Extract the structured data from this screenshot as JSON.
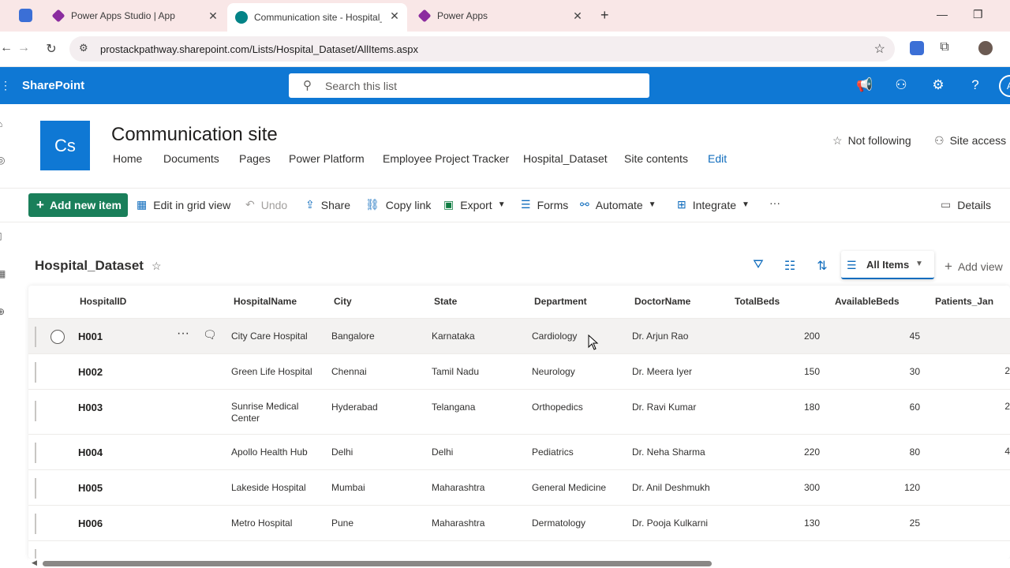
{
  "browser": {
    "tabs": [
      {
        "title": "Power Apps Studio | App",
        "color": "#8b2c9f"
      },
      {
        "title": "Communication site - Hospital_",
        "color": "#038387"
      },
      {
        "title": "Power Apps",
        "color": "#8b2c9f"
      }
    ],
    "url": "prostackpathway.sharepoint.com/Lists/Hospital_Dataset/AllItems.aspx",
    "new_tab": "+"
  },
  "suitebar": {
    "brand": "SharePoint",
    "search_placeholder": "Search this list",
    "avatar_initial": "A"
  },
  "site": {
    "logo": "Cs",
    "title": "Communication site",
    "nav": [
      "Home",
      "Documents",
      "Pages",
      "Power Platform",
      "Employee Project Tracker",
      "Hospital_Dataset",
      "Site contents",
      "Edit"
    ],
    "not_following": "Not following",
    "site_access": "Site access"
  },
  "commands": {
    "new_item": "Add new item",
    "grid_view": "Edit in grid view",
    "undo": "Undo",
    "share": "Share",
    "copy_link": "Copy link",
    "export": "Export",
    "forms": "Forms",
    "automate": "Automate",
    "integrate": "Integrate",
    "more": "···",
    "details": "Details"
  },
  "list": {
    "title": "Hospital_Dataset",
    "view": "All Items",
    "add_view": "Add view",
    "columns": [
      "HospitalID",
      "HospitalName",
      "City",
      "State",
      "Department",
      "DoctorName",
      "TotalBeds",
      "AvailableBeds",
      "Patients_Jan"
    ],
    "rows": [
      {
        "id": "H001",
        "name": "City Care Hospital",
        "city": "Bangalore",
        "state": "Karnataka",
        "dept": "Cardiology",
        "doctor": "Dr. Arjun Rao",
        "total": "200",
        "avail": "45"
      },
      {
        "id": "H002",
        "name": "Green Life Hospital",
        "city": "Chennai",
        "state": "Tamil Nadu",
        "dept": "Neurology",
        "doctor": "Dr. Meera Iyer",
        "total": "150",
        "avail": "30"
      },
      {
        "id": "H003",
        "name": "Sunrise Medical Center",
        "city": "Hyderabad",
        "state": "Telangana",
        "dept": "Orthopedics",
        "doctor": "Dr. Ravi Kumar",
        "total": "180",
        "avail": "60"
      },
      {
        "id": "H004",
        "name": "Apollo Health Hub",
        "city": "Delhi",
        "state": "Delhi",
        "dept": "Pediatrics",
        "doctor": "Dr. Neha Sharma",
        "total": "220",
        "avail": "80"
      },
      {
        "id": "H005",
        "name": "Lakeside Hospital",
        "city": "Mumbai",
        "state": "Maharashtra",
        "dept": "General Medicine",
        "doctor": "Dr. Anil Deshmukh",
        "total": "300",
        "avail": "120"
      },
      {
        "id": "H006",
        "name": "Metro Hospital",
        "city": "Pune",
        "state": "Maharashtra",
        "dept": "Dermatology",
        "doctor": "Dr. Pooja Kulkarni",
        "total": "130",
        "avail": "25"
      }
    ]
  }
}
